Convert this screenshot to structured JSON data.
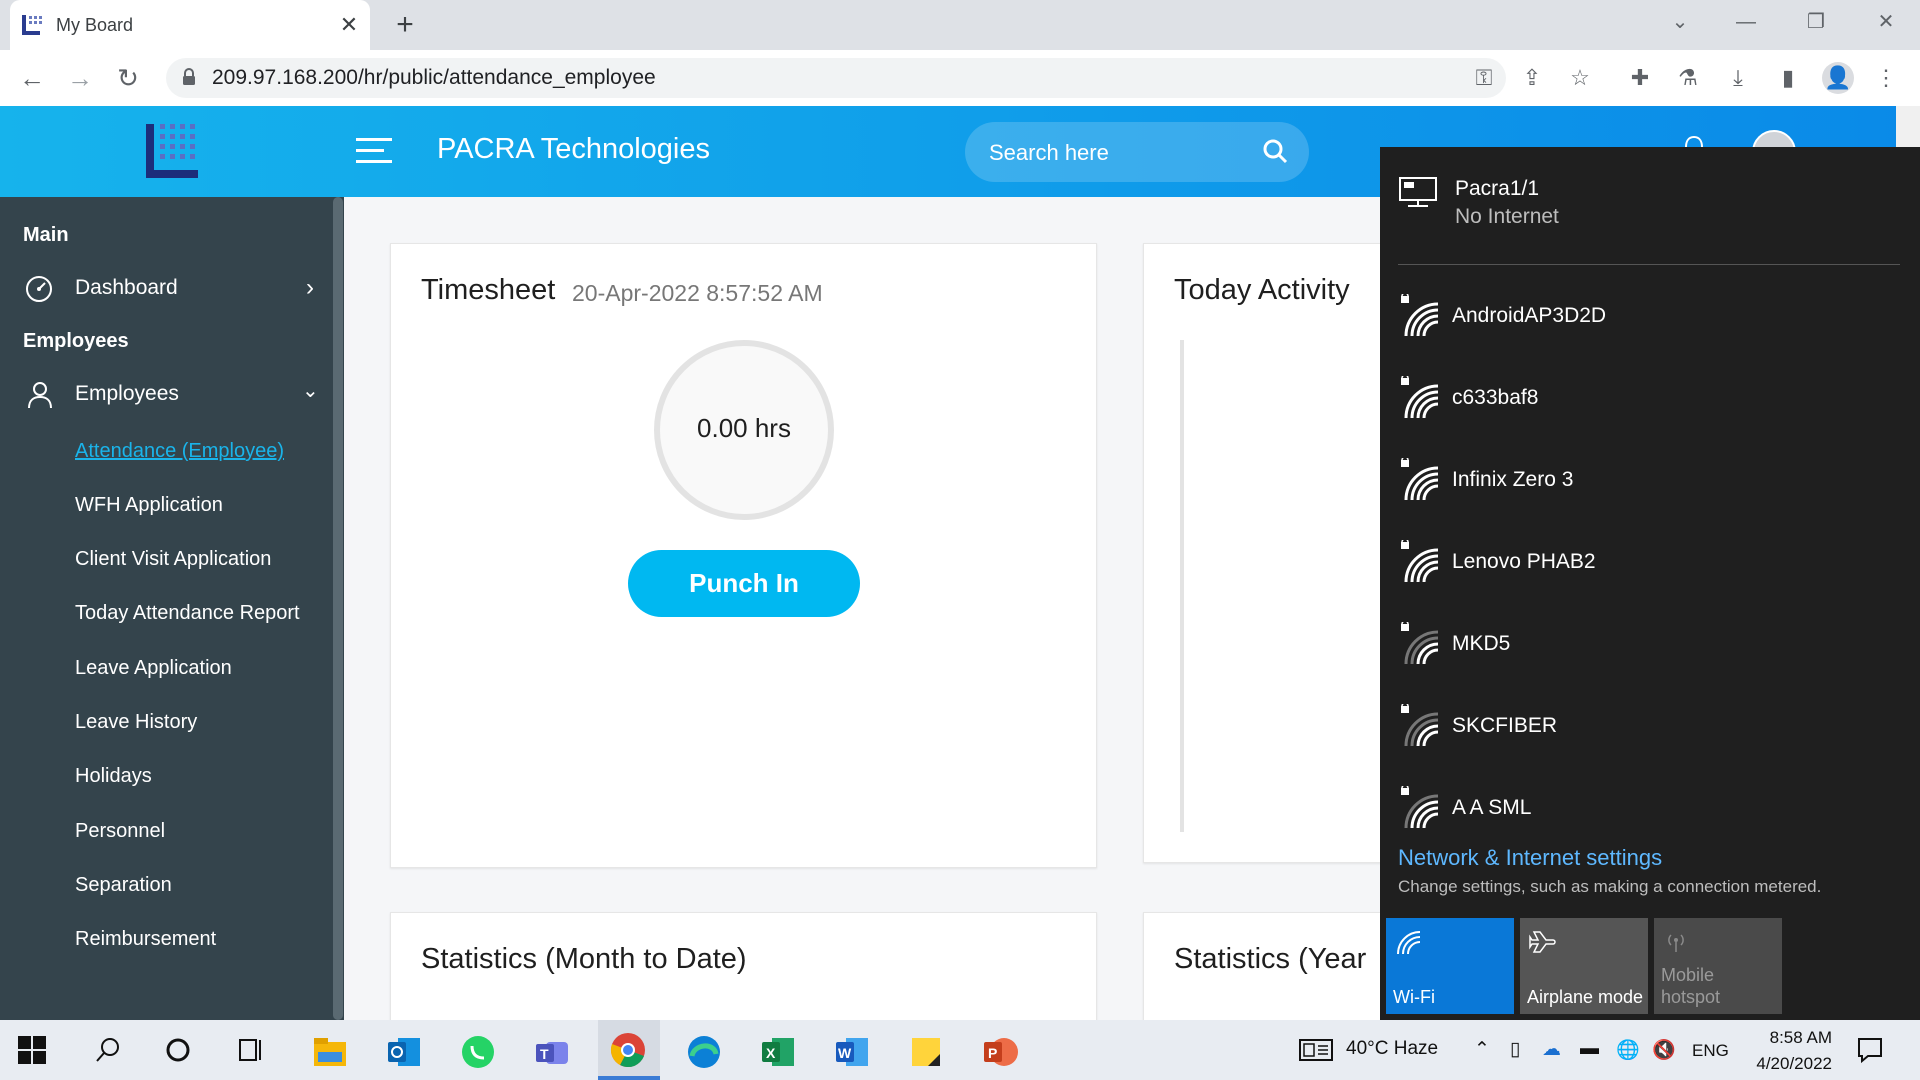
{
  "browser": {
    "tab_title": "My Board",
    "url": "209.97.168.200/hr/public/attendance_employee"
  },
  "header": {
    "company": "PACRA Technologies",
    "search_placeholder": "Search here"
  },
  "sidebar": {
    "section_main": "Main",
    "dashboard": "Dashboard",
    "section_employees": "Employees",
    "employees": "Employees",
    "subitems": [
      "Attendance (Employee)",
      "WFH Application",
      "Client Visit Application",
      "Today Attendance Report",
      "Leave Application",
      "Leave History",
      "Holidays",
      "Personnel",
      "Separation",
      "Reimbursement"
    ]
  },
  "timesheet": {
    "title": "Timesheet",
    "datetime": "20-Apr-2022 8:57:52 AM",
    "hours": "0.00 hrs",
    "punch_label": "Punch In"
  },
  "today_activity": {
    "title": "Today Activity"
  },
  "stats_month": {
    "title": "Statistics (Month to Date)"
  },
  "stats_year": {
    "title": "Statistics (Year"
  },
  "network_flyout": {
    "current": {
      "name": "Pacra1/1",
      "status": "No Internet"
    },
    "networks": [
      {
        "name": "AndroidAP3D2D",
        "strength": 4
      },
      {
        "name": "c633baf8",
        "strength": 4
      },
      {
        "name": "Infinix Zero 3",
        "strength": 4
      },
      {
        "name": "Lenovo PHAB2",
        "strength": 4
      },
      {
        "name": "MKD5",
        "strength": 2
      },
      {
        "name": "SKCFIBER",
        "strength": 2
      },
      {
        "name": "A A SML",
        "strength": 3
      }
    ],
    "settings_link": "Network & Internet settings",
    "settings_desc": "Change settings, such as making a connection metered.",
    "quick_actions": [
      {
        "label": "Wi-Fi",
        "active": true
      },
      {
        "label": "Airplane mode",
        "active": false
      },
      {
        "label": "Mobile hotspot",
        "active": false
      }
    ]
  },
  "taskbar": {
    "weather": "40°C  Haze",
    "language": "ENG",
    "time": "8:58 AM",
    "date": "4/20/2022"
  },
  "colors": {
    "header_from": "#16b3ec",
    "header_to": "#0a8ae8",
    "sidebar": "#34444c",
    "accent": "#00b8f1",
    "wifi_tile_active": "#0a78d7",
    "flyout_bg": "#1f1f1f"
  }
}
